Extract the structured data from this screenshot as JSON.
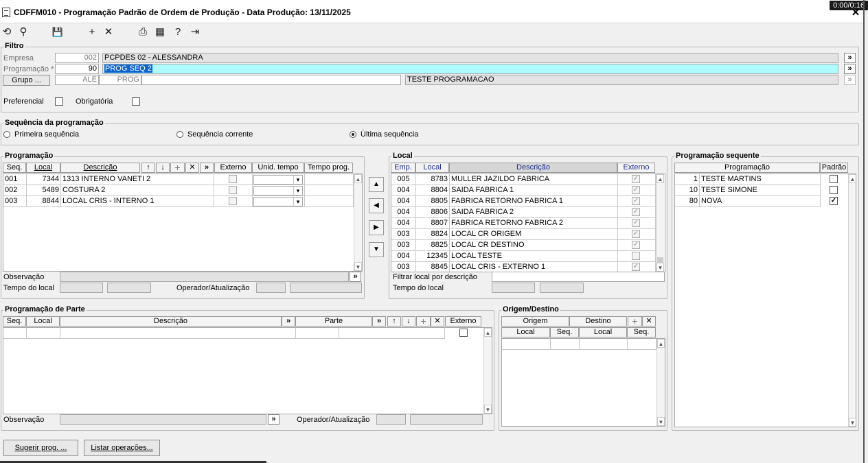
{
  "window": {
    "title": "CDFFM010 - Programação Padrão de Ordem de Produção - Data Produção: 13/11/2025",
    "timer": "0:00/0:16",
    "close": "✕"
  },
  "toolbar": {
    "refresh": "⟲",
    "search": "⚲",
    "save": "💾",
    "add": "+",
    "delete": "✕",
    "print": "⎙",
    "calendar": "▦",
    "help": "?",
    "exit": "⇥"
  },
  "filtro": {
    "title": "Filtro",
    "empresa_label": "Empresa",
    "empresa_code": "002",
    "empresa_name": "PCPDES 02 - ALESSANDRA",
    "programacao_label": "Programação *",
    "programacao_code": "90",
    "programacao_name": "PROG SEQ 2",
    "grupo_button": "Grupo ...",
    "grupo_code1": "ALE",
    "grupo_code2": "PROG",
    "grupo_name": "TESTE PROGRAMACAO",
    "lookup": "»",
    "preferencial_label": "Preferencial",
    "obrigatoria_label": "Obrigatória"
  },
  "sequencia": {
    "title": "Sequência da programação",
    "options": [
      "Primeira sequência",
      "Sequência corrente",
      "Última sequência"
    ],
    "selected": 2
  },
  "programacao": {
    "title": "Programação",
    "headers": {
      "seq": "Seq.",
      "local": "Local",
      "descricao": "Descrição",
      "up": "↑",
      "down": "↓",
      "add": "+",
      "remove": "✕",
      "more": "»",
      "externo": "Externo",
      "unid": "Unid. tempo",
      "tempo": "Tempo prog."
    },
    "rows": [
      {
        "seq": "001",
        "local": "7344",
        "descricao": "1313 INTERNO VANETI 2"
      },
      {
        "seq": "002",
        "local": "5489",
        "descricao": "COSTURA 2"
      },
      {
        "seq": "003",
        "local": "8844",
        "descricao": "LOCAL CRIS - INTERNO 1"
      }
    ],
    "observacao_label": "Observação",
    "tempo_local_label": "Tempo do local",
    "operador_label": "Operador/Atualização",
    "obs_button": "»"
  },
  "mover": {
    "up": "▲",
    "left": "◀",
    "right": "▶",
    "down": "▼"
  },
  "local": {
    "title": "Local",
    "headers": {
      "emp": "Emp.",
      "local": "Local",
      "descricao": "Descrição",
      "externo": "Externo"
    },
    "rows": [
      {
        "emp": "005",
        "local": "8783",
        "descricao": "MULLER JAZILDO FABRICA",
        "externo": true
      },
      {
        "emp": "004",
        "local": "8804",
        "descricao": "SAIDA FABRICA 1",
        "externo": true
      },
      {
        "emp": "004",
        "local": "8805",
        "descricao": "FABRICA RETORNO FABRICA 1",
        "externo": true
      },
      {
        "emp": "004",
        "local": "8806",
        "descricao": "SAIDA FABRICA 2",
        "externo": true
      },
      {
        "emp": "004",
        "local": "8807",
        "descricao": "FABRICA RETORNO FABRICA 2",
        "externo": true
      },
      {
        "emp": "003",
        "local": "8824",
        "descricao": "LOCAL CR ORIGEM",
        "externo": true
      },
      {
        "emp": "003",
        "local": "8825",
        "descricao": "LOCAL CR DESTINO",
        "externo": true
      },
      {
        "emp": "004",
        "local": "12345",
        "descricao": "LOCAL TESTE",
        "externo": false
      },
      {
        "emp": "003",
        "local": "8845",
        "descricao": "LOCAL CRIS - EXTERNO 1",
        "externo": true
      }
    ],
    "filtrar_label": "Filtrar local por descrição",
    "tempo_local_label": "Tempo do local"
  },
  "sequente": {
    "title": "Programação sequente",
    "headers": {
      "programacao": "Programação",
      "padrao": "Padrão"
    },
    "rows": [
      {
        "code": "1",
        "name": "TESTE MARTINS",
        "padrao": false
      },
      {
        "code": "10",
        "name": "TESTE SIMONE",
        "padrao": false
      },
      {
        "code": "80",
        "name": "NOVA",
        "padrao": true
      }
    ]
  },
  "parte": {
    "title": "Programação de Parte",
    "headers": {
      "seq": "Seq.",
      "local": "Local",
      "descricao": "Descrição",
      "more": "»",
      "parte": "Parte",
      "up": "↑",
      "down": "↓",
      "add": "+",
      "remove": "✕",
      "externo": "Externo"
    },
    "observacao_label": "Observação",
    "operador_label": "Operador/Atualização",
    "obs_button": "»"
  },
  "origem_destino": {
    "title": "Origem/Destino",
    "origem": "Origem",
    "destino": "Destino",
    "add": "+",
    "remove": "✕",
    "local": "Local",
    "seq": "Seq."
  },
  "footer": {
    "sugerir": "Sugerir prog. ...",
    "listar": "Listar operações..."
  },
  "check_mark": "✓"
}
